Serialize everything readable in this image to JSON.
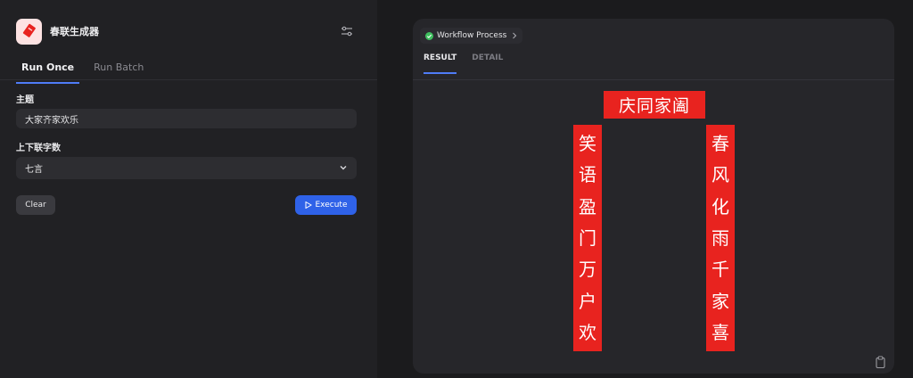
{
  "app": {
    "title": "春联生成器"
  },
  "tabs": [
    {
      "label": "Run Once",
      "active": true
    },
    {
      "label": "Run Batch",
      "active": false
    }
  ],
  "form": {
    "topic": {
      "label": "主题",
      "value": "大家齐家欢乐"
    },
    "char_count": {
      "label": "上下联字数",
      "value": "七言"
    }
  },
  "actions": {
    "clear": "Clear",
    "execute": "Execute"
  },
  "result": {
    "workflow_label": "Workflow Process",
    "tabs": [
      {
        "label": "RESULT",
        "active": true
      },
      {
        "label": "DETAIL",
        "active": false
      }
    ],
    "hengpi": "庆同家阖",
    "left_couplet": [
      "笑",
      "语",
      "盈",
      "门",
      "万",
      "户",
      "欢"
    ],
    "right_couplet": [
      "春",
      "风",
      "化",
      "雨",
      "千",
      "家",
      "喜"
    ]
  },
  "colors": {
    "accent": "#2f62e8",
    "tab_underline": "#4f7cf7",
    "couplet_red": "#e8231f",
    "success": "#3fbf5f"
  },
  "icons": [
    "app-logo-icon",
    "settings-sliders-icon",
    "chevron-down-icon",
    "play-icon",
    "check-circle-icon",
    "chevron-right-icon",
    "clipboard-icon"
  ]
}
